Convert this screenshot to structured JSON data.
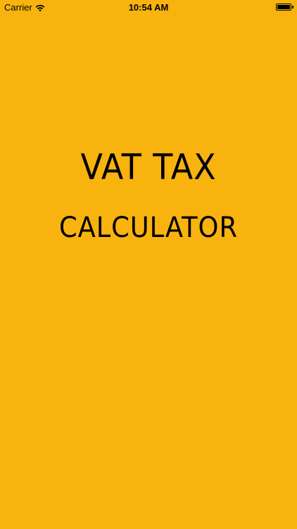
{
  "status_bar": {
    "carrier": "Carrier",
    "time": "10:54 AM",
    "wifi_icon": "wifi-icon",
    "battery_icon": "battery-icon",
    "battery_level": 1.0
  },
  "splash": {
    "title_line1": "VAT TAX",
    "title_line2": "CALCULATOR"
  },
  "colors": {
    "background": "#F9B30F",
    "text": "#000000"
  }
}
